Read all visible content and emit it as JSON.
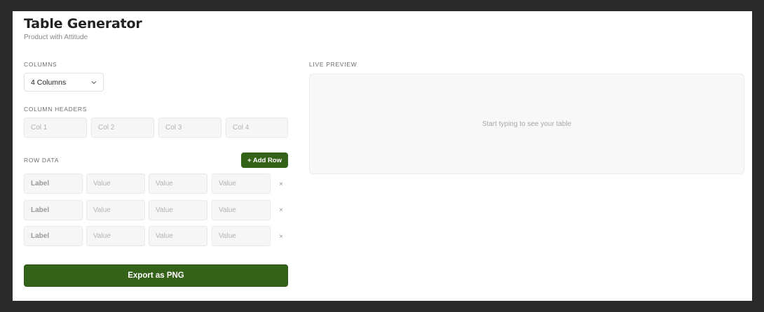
{
  "header": {
    "title": "Table Generator",
    "subtitle": "Product with Attitude"
  },
  "columns": {
    "label": "COLUMNS",
    "selected": "4 Columns"
  },
  "column_headers": {
    "label": "COLUMN HEADERS",
    "placeholders": [
      "Col 1",
      "Col 2",
      "Col 3",
      "Col 4"
    ]
  },
  "row_data": {
    "label": "ROW DATA",
    "add_row_label": "+ Add Row",
    "remove_symbol": "×",
    "rows": [
      {
        "label_placeholder": "Label",
        "value_placeholders": [
          "Value",
          "Value",
          "Value"
        ]
      },
      {
        "label_placeholder": "Label",
        "value_placeholders": [
          "Value",
          "Value",
          "Value"
        ]
      },
      {
        "label_placeholder": "Label",
        "value_placeholders": [
          "Value",
          "Value",
          "Value"
        ]
      }
    ]
  },
  "export": {
    "label": "Export as PNG"
  },
  "preview": {
    "label": "LIVE PREVIEW",
    "empty_text": "Start typing to see your table"
  },
  "colors": {
    "accent": "#356219",
    "background": "#2b2b2b",
    "panel": "#ffffff"
  }
}
